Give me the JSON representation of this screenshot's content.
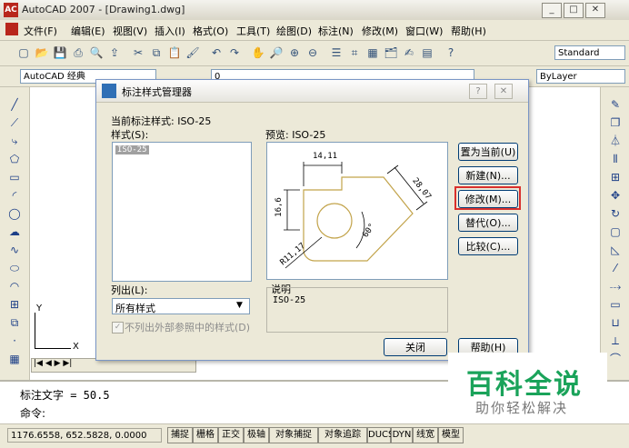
{
  "window": {
    "title": "AutoCAD 2007 - [Drawing1.dwg]",
    "logo": "AC",
    "minimize": "_",
    "restore": "□",
    "close": "✕"
  },
  "menu": [
    "文件(F)",
    "编辑(E)",
    "视图(V)",
    "插入(I)",
    "格式(O)",
    "工具(T)",
    "绘图(D)",
    "标注(N)",
    "修改(M)",
    "窗口(W)",
    "帮助(H)"
  ],
  "toolbar": {
    "text_style": "Standard",
    "workspace": "AutoCAD 经典",
    "layer": "0",
    "color": "ByLayer",
    "icons": [
      "new-icon",
      "open-icon",
      "save-icon",
      "plot-icon",
      "preview-icon",
      "publish-icon",
      "cut-icon",
      "copy-icon",
      "paste-icon",
      "matchprop-icon",
      "undo-icon",
      "redo-icon",
      "pan-icon",
      "zoom-realtime-icon",
      "zoom-window-icon",
      "zoom-previous-icon",
      "properties-icon",
      "designcenter-icon",
      "toolpalette-icon",
      "sheetset-icon",
      "markup-icon",
      "calc-icon",
      "help-icon"
    ]
  },
  "dialog": {
    "title": "标注样式管理器",
    "help": "?",
    "close": "✕",
    "current_style_label": "当前标注样式: ISO-25",
    "styles_label": "样式(S):",
    "styles": [
      "ISO-25"
    ],
    "list_label": "列出(L):",
    "list_value": "所有样式",
    "checkbox_label": "不列出外部参照中的样式(D)",
    "preview_label": "预览: ISO-25",
    "description_label": "说明",
    "description_value": "ISO-25",
    "buttons": {
      "set_current": "置为当前(U)",
      "new": "新建(N)...",
      "modify": "修改(M)...",
      "override": "替代(O)...",
      "compare": "比较(C)...",
      "close": "关闭",
      "help": "帮助(H)"
    },
    "preview_dims": {
      "top": "14,11",
      "left": "16,6",
      "right": "28,07",
      "angle": "60°",
      "radius": "R11,17"
    },
    "highlight_color": "#d9302c"
  },
  "command": {
    "line1": "标注文字 = 50.5",
    "line2": "命令:"
  },
  "status": {
    "coords": "1176.6558, 652.5828, 0.0000",
    "buttons": [
      "捕捉",
      "栅格",
      "正交",
      "极轴",
      "对象捕捉",
      "对象追踪",
      "DUCS",
      "DYN",
      "线宽",
      "模型"
    ]
  },
  "ucs": {
    "x": "X",
    "y": "Y"
  },
  "watermark": {
    "title": "百科全说",
    "subtitle": "助你轻松解决",
    "color": "#1aa35a"
  }
}
